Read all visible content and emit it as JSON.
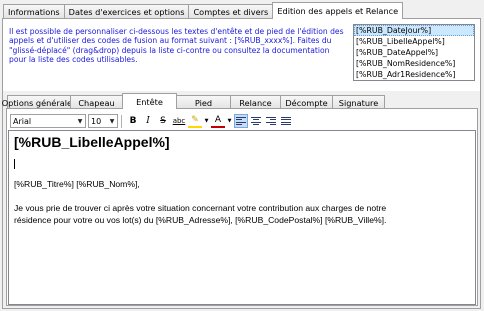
{
  "top_tabs": [
    "Informations",
    "Dates d'exercices et options",
    "Comptes et divers",
    "Edition des appels et Relance"
  ],
  "info_text": "Il est possible de personnaliser ci-dessous les textes d'entête et de pied de l'édition des appels et d'utiliser des codes de fusion au format suivant : [%RUB_xxxx%]. Faites du \"glissé-déplacé\" (drag&drop) depuis la liste ci-contre ou consultez la documentation pour la liste des codes utilisables.",
  "fusion_codes": [
    "[%RUB_DateJour%]",
    "[%RUB_LibelleAppel%]",
    "[%RUB_DateAppel%]",
    "[%RUB_NomResidence%]",
    "[%RUB_Adr1Residence%]"
  ],
  "sub_tabs": [
    "Options générales",
    "Chapeau",
    "Entête",
    "Pied",
    "Relance",
    "Décompte",
    "Signature"
  ],
  "toolbar": {
    "font": "Arial",
    "size": "10",
    "bold": "B",
    "italic": "I",
    "strike": "S",
    "underline": "abc",
    "highlight": "✎",
    "fontcolor": "A"
  },
  "editor": {
    "title": "[%RUB_LibelleAppel%]",
    "line1": "[%RUB_Titre%] [%RUB_Nom%],",
    "line2": "Je vous prie de trouver ci après votre situation concernant votre contribution aux charges de notre",
    "line3": "résidence pour votre ou vos lot(s) du [%RUB_Adresse%], [%RUB_CodePostal%] [%RUB_Ville%]."
  }
}
